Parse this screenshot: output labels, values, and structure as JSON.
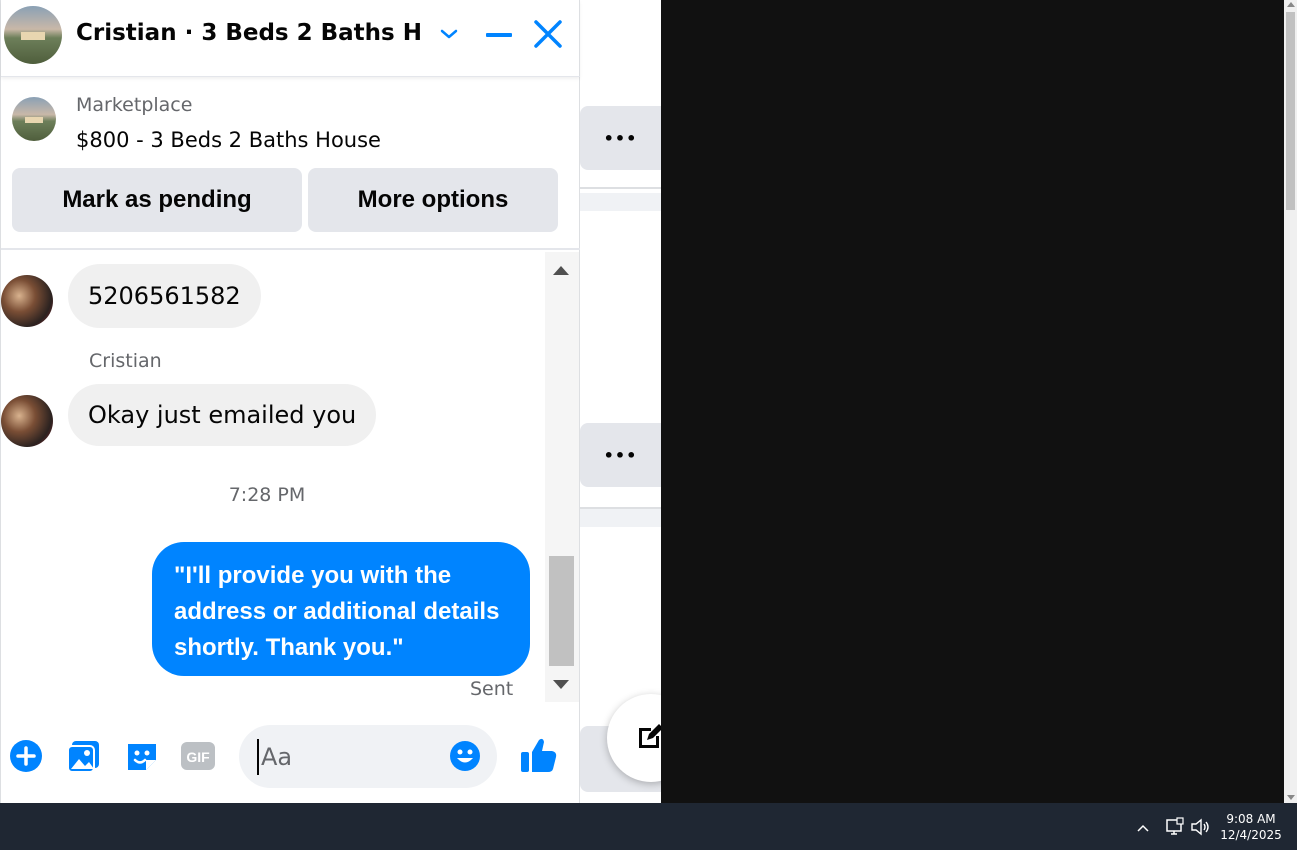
{
  "header": {
    "title": "Cristian · 3 Beds 2 Baths H···"
  },
  "listing": {
    "source": "Marketplace",
    "title": "$800 - 3 Beds 2 Baths House",
    "buttons": {
      "pending": "Mark as pending",
      "more": "More options"
    }
  },
  "messages": [
    {
      "text": "5206561582",
      "direction": "incoming"
    },
    {
      "sender": "Cristian",
      "text": "Okay just emailed you",
      "direction": "incoming"
    },
    {
      "timestamp": "7:28 PM"
    },
    {
      "text": "\"I'll provide you with the address or additional details shortly. Thank you.\"",
      "direction": "outgoing",
      "status": "Sent"
    }
  ],
  "composer": {
    "placeholder": "Aa",
    "value": ""
  },
  "background": {
    "more_label": "•••"
  },
  "taskbar": {
    "time": "9:08 AM",
    "date": "12/4/2025"
  },
  "colors": {
    "accent": "#0084ff",
    "bubble_incoming": "#f0f0f0",
    "button_bg": "#e4e6eb",
    "desktop_dark": "#111111",
    "taskbar": "#1f2733"
  },
  "icons": {
    "header": [
      "chevron-down-icon",
      "minimize-icon",
      "close-icon"
    ],
    "composer": [
      "plus-icon",
      "photo-icon",
      "sticker-icon",
      "gif-icon",
      "emoji-icon",
      "like-icon"
    ],
    "tray": [
      "chevron-up-icon",
      "network-icon",
      "volume-icon"
    ],
    "background": [
      "compose-icon"
    ]
  }
}
